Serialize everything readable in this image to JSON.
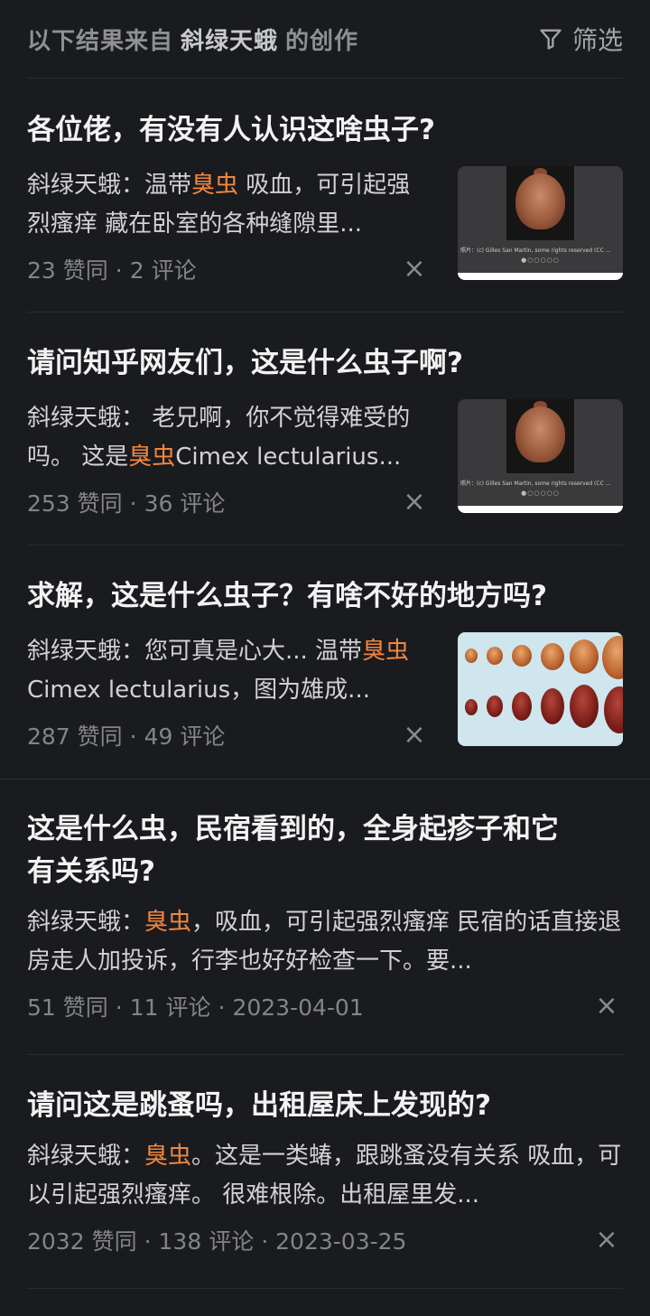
{
  "header": {
    "prefix": "以下结果来自",
    "author": "斜绿天蛾",
    "suffix": "的创作",
    "filter_label": "筛选"
  },
  "results": [
    {
      "title": "各位佬，有没有人认识这啥虫子?",
      "excerpt_before": "斜绿天蛾：温带",
      "excerpt_highlight": "臭虫",
      "excerpt_after": " 吸血，可引起强烈瘙痒 藏在卧室的各种缝隙里...",
      "likes": "23 赞同",
      "comments": "2 评论",
      "thumb_caption": "照片：(c) Gilles San Martin, some rights reserved (CC ...",
      "thumb_dots": "●○○○○○"
    },
    {
      "title": "请问知乎网友们，这是什么虫子啊?",
      "excerpt_before": "斜绿天蛾： 老兄啊，你不觉得难受的吗。 这是",
      "excerpt_highlight": "臭虫",
      "excerpt_after": "Cimex lectularius...",
      "likes": "253 赞同",
      "comments": "36 评论",
      "thumb_caption": "照片：(c) Gilles San Martin, some rights reserved (CC ...",
      "thumb_dots": "●○○○○○"
    },
    {
      "title": "求解，这是什么虫子？有啥不好的地方吗?",
      "excerpt_before": "斜绿天蛾：您可真是心大... 温带",
      "excerpt_highlight": "臭虫",
      "excerpt_after": "Cimex lectularius，图为雄成...",
      "likes": "287 赞同",
      "comments": "49 评论"
    },
    {
      "title_line1": "这是什么虫，民宿看到的，全身起疹子和它",
      "title_line2": "有关系吗?",
      "excerpt_before": "斜绿天蛾：",
      "excerpt_highlight": "臭虫",
      "excerpt_after": "，吸血，可引起强烈瘙痒 民宿的话直接退房走人加投诉，行李也好好检查一下。要...",
      "likes": "51 赞同",
      "comments": "11 评论",
      "date": "2023-04-01"
    },
    {
      "title": "请问这是跳蚤吗，出租屋床上发现的?",
      "excerpt_before": "斜绿天蛾：",
      "excerpt_highlight": "臭虫",
      "excerpt_after": "。这是一类蝽，跟跳蚤没有关系 吸血，可以引起强烈瘙痒。 很难根除。出租屋里发...",
      "likes": "2032 赞同",
      "comments": "138 评论",
      "date": "2023-03-25"
    }
  ],
  "close_glyph": "×",
  "dot_separator": "·",
  "colors": {
    "background": "#1a1b1f",
    "highlight": "#f1873f"
  }
}
